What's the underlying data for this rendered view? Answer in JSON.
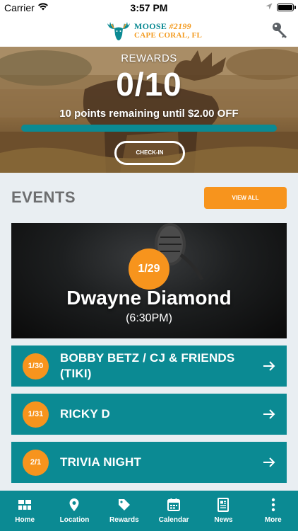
{
  "status_bar": {
    "carrier": "Carrier",
    "time": "3:57 PM"
  },
  "header": {
    "logo_line1": "MOOSE",
    "logo_lodge": "#2199",
    "logo_line2": "CAPE CORAL, FL",
    "logo_icon": "moose-logo",
    "action_icon": "key-icon"
  },
  "rewards": {
    "label": "REWARDS",
    "points": "0/10",
    "remaining": "10 points remaining until $2.00 OFF",
    "progress": 0,
    "checkin_label": "CHECK-IN"
  },
  "events": {
    "title": "EVENTS",
    "view_all_label": "VIEW ALL",
    "featured": {
      "date": "1/29",
      "title": "Dwayne Diamond",
      "time": "(6:30PM)"
    },
    "items": [
      {
        "date": "1/30",
        "title": "BOBBY BETZ / CJ & FRIENDS (TIKI)"
      },
      {
        "date": "1/31",
        "title": "RICKY D"
      },
      {
        "date": "2/1",
        "title": "TRIVIA NIGHT"
      }
    ]
  },
  "tabs": [
    {
      "label": "Home",
      "icon": "home-grid-icon"
    },
    {
      "label": "Location",
      "icon": "map-pin-icon"
    },
    {
      "label": "Rewards",
      "icon": "tag-icon"
    },
    {
      "label": "Calendar",
      "icon": "calendar-icon"
    },
    {
      "label": "News",
      "icon": "newspaper-icon"
    },
    {
      "label": "More",
      "icon": "more-dots-icon"
    }
  ],
  "colors": {
    "teal": "#0b8a93",
    "orange": "#f7941d",
    "background": "#e9eef2"
  }
}
